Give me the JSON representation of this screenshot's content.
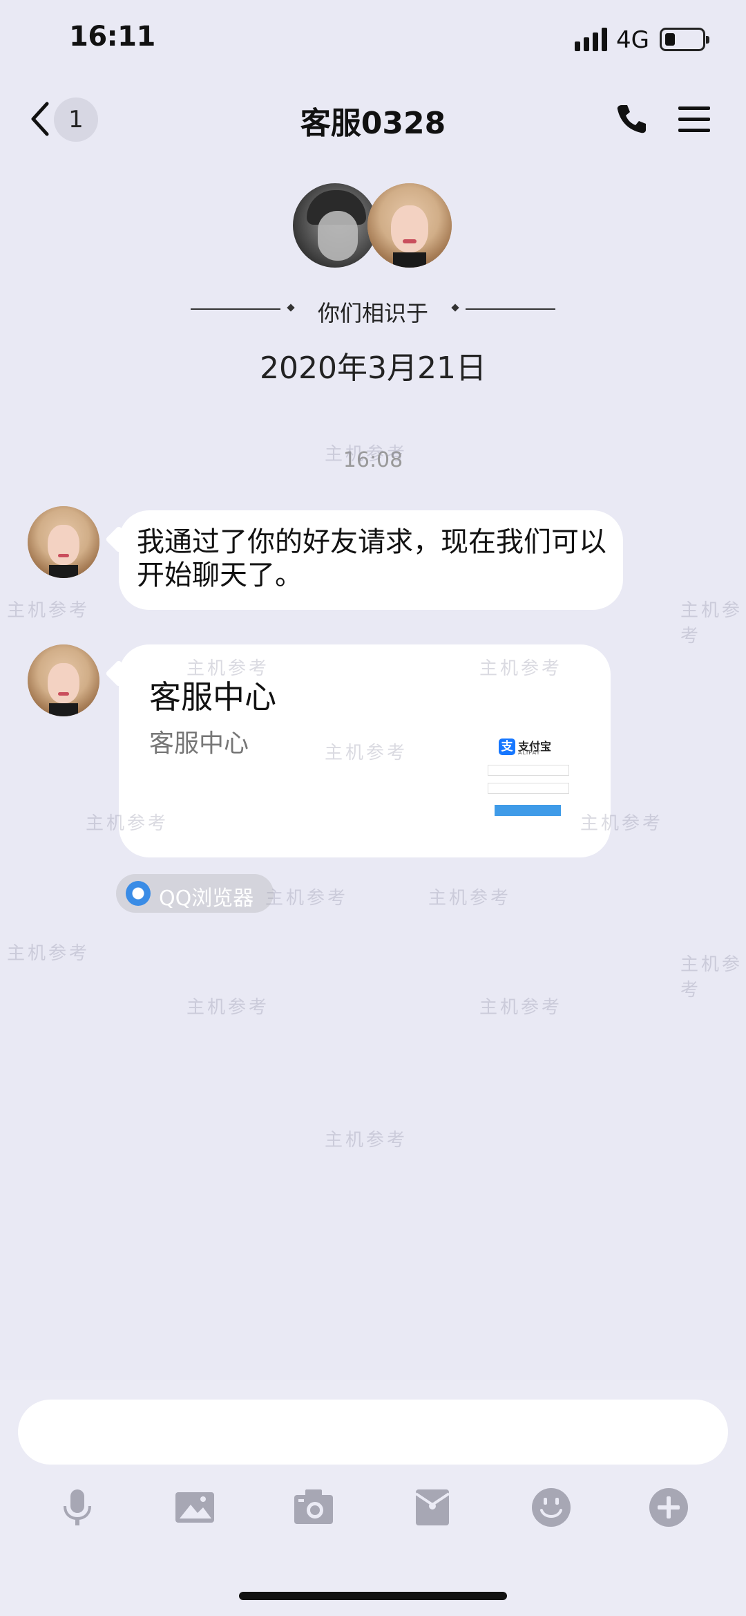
{
  "status_bar": {
    "time": "16:11",
    "network": "4G"
  },
  "nav": {
    "unread_count": "1",
    "title": "客服0328"
  },
  "header": {
    "met_label": "你们相识于",
    "met_date": "2020年3月21日"
  },
  "messages": {
    "timestamp": "16:08",
    "text": "我通过了你的好友请求，现在我们可以开始聊天了。",
    "card": {
      "title": "客服中心",
      "subtitle": "客服中心",
      "thumb_logo": "支付宝",
      "thumb_logo_sub": "ALIPAY"
    },
    "source": "QQ浏览器"
  },
  "watermark": "主机参考",
  "input": {
    "placeholder": ""
  },
  "toolbar": {
    "icons": [
      "microphone-icon",
      "image-icon",
      "camera-icon",
      "red-packet-icon",
      "emoji-icon",
      "plus-icon"
    ]
  },
  "colors": {
    "background": "#e9e9f4",
    "bubble": "#ffffff",
    "accent": "#1677ff"
  }
}
